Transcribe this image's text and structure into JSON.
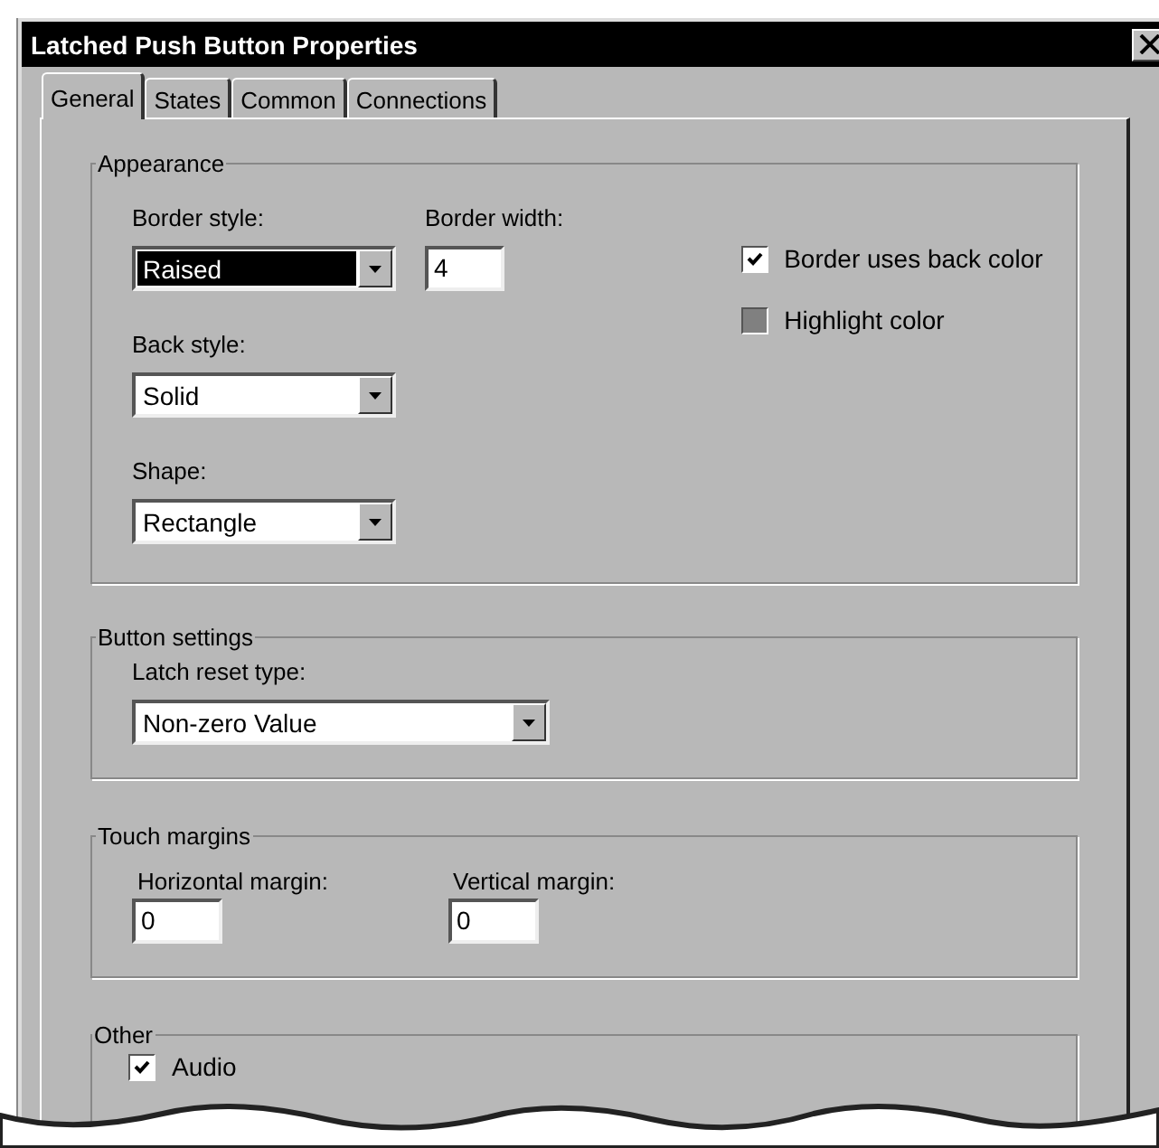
{
  "window": {
    "title": "Latched Push Button Properties"
  },
  "tabs": [
    {
      "label": "General",
      "selected": true
    },
    {
      "label": "States",
      "selected": false
    },
    {
      "label": "Common",
      "selected": false
    },
    {
      "label": "Connections",
      "selected": false
    }
  ],
  "appearance": {
    "title": "Appearance",
    "dropdowns": [
      {
        "label": "Border style:",
        "value": "Raised",
        "focused": true
      },
      {
        "label": "Back style:",
        "value": "Solid",
        "focused": false
      },
      {
        "label": "Shape:",
        "value": "Rectangle",
        "focused": false
      }
    ],
    "border_width": {
      "label": "Border width:",
      "value": "4"
    },
    "checkboxes": [
      {
        "label": "Border uses back color",
        "checked": true,
        "disabled": false
      },
      {
        "label": "Highlight color",
        "checked": false,
        "disabled": true
      }
    ]
  },
  "button_settings": {
    "title": "Button settings",
    "latch_reset_type": {
      "label": "Latch reset type:",
      "value": "Non-zero Value"
    }
  },
  "touch_margins": {
    "title": "Touch margins",
    "fields": [
      {
        "label": "Horizontal  margin:",
        "value": "0"
      },
      {
        "label": "Vertical margin:",
        "value": "0"
      }
    ]
  },
  "other": {
    "title": "Other",
    "checkboxes": [
      {
        "label": "Audio",
        "checked": true
      }
    ]
  }
}
